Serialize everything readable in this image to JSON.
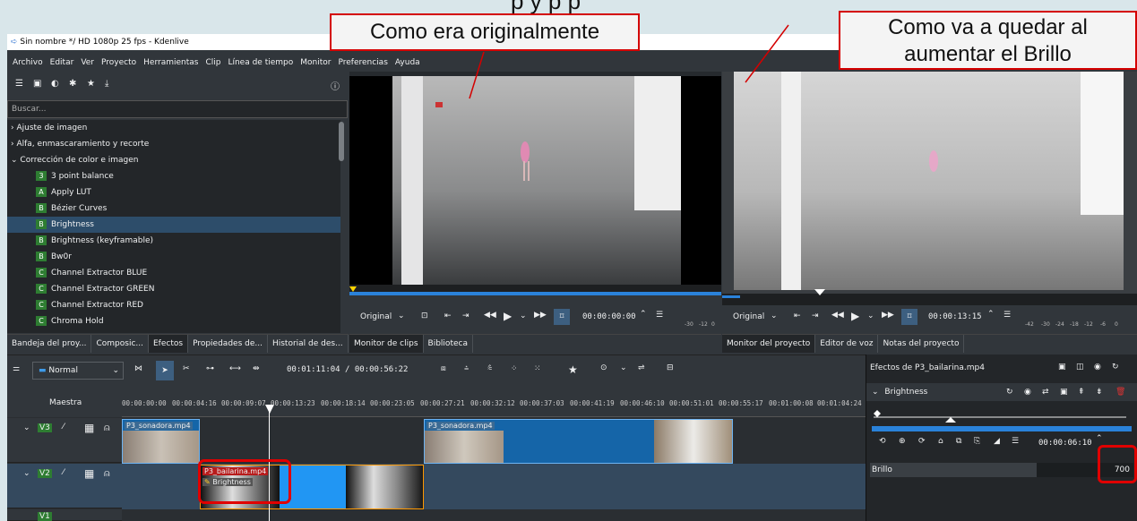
{
  "slide_top_text": "p      y        p                    p",
  "callouts": {
    "left": "Como era originalmente",
    "right_line1": "Como va a quedar al",
    "right_line2": "aumentar el Brillo"
  },
  "window": {
    "title": "Sin nombre */ HD 1080p 25 fps - Kdenlive"
  },
  "menu": [
    "Archivo",
    "Editar",
    "Ver",
    "Proyecto",
    "Herramientas",
    "Clip",
    "Línea de tiempo",
    "Monitor",
    "Preferencias",
    "Ayuda"
  ],
  "effects_panel": {
    "search_placeholder": "Buscar...",
    "categories": [
      "Ajuste de imagen",
      "Alfa, enmascaramiento y recorte",
      "Corrección de color e imagen"
    ],
    "items": [
      {
        "badge": "3",
        "label": "3 point balance"
      },
      {
        "badge": "A",
        "label": "Apply LUT"
      },
      {
        "badge": "B",
        "label": "Bézier Curves"
      },
      {
        "badge": "B",
        "label": "Brightness"
      },
      {
        "badge": "B",
        "label": "Brightness (keyframable)"
      },
      {
        "badge": "B",
        "label": "Bw0r"
      },
      {
        "badge": "C",
        "label": "Channel Extractor BLUE"
      },
      {
        "badge": "C",
        "label": "Channel Extractor GREEN"
      },
      {
        "badge": "C",
        "label": "Channel Extractor RED"
      },
      {
        "badge": "C",
        "label": "Chroma Hold"
      }
    ]
  },
  "left_tabs": [
    "Bandeja del proy...",
    "Composic...",
    "Efectos",
    "Propiedades de...",
    "Historial de des..."
  ],
  "clip_monitor": {
    "mode": "Original",
    "timecode": "00:00:00:00",
    "tabs": [
      "Monitor de clips",
      "Biblioteca"
    ],
    "meter": [
      "-30",
      "-12",
      "0"
    ]
  },
  "project_monitor": {
    "mode": "Original",
    "timecode": "00:00:13:15",
    "tabs": [
      "Monitor del proyecto",
      "Editor de voz",
      "Notas del proyecto"
    ],
    "meter": [
      "-42",
      "-30",
      "-24",
      "-18",
      "-12",
      "-6",
      "0"
    ]
  },
  "timeline": {
    "mode": "Normal",
    "timecode": "00:01:11:04 / 00:00:56:22",
    "master": "Maestra",
    "ruler": [
      "00:00:00:00",
      "00:00:04:16",
      "00:00:09:07",
      "00:00:13:23",
      "00:00:18:14",
      "00:00:23:05",
      "00:00:27:21",
      "00:00:32:12",
      "00:00:37:03",
      "00:00:41:19",
      "00:00:46:10",
      "00:00:51:01",
      "00:00:55:17",
      "00:01:00:08",
      "00:01:04:24"
    ],
    "tracks": [
      "V3",
      "V2",
      "V1"
    ],
    "clips": {
      "v3_a": "P3_sonadora.mp4",
      "v3_b": "P3_sonadora.mp4",
      "v2_a": "P3_bailarina.mp4",
      "v2_effect": "Brightness"
    }
  },
  "effect_stack": {
    "title": "Efectos de P3_bailarina.mp4",
    "effect": "Brightness",
    "timecode": "00:00:06:10",
    "param_label": "Brillo",
    "param_value": "700"
  }
}
